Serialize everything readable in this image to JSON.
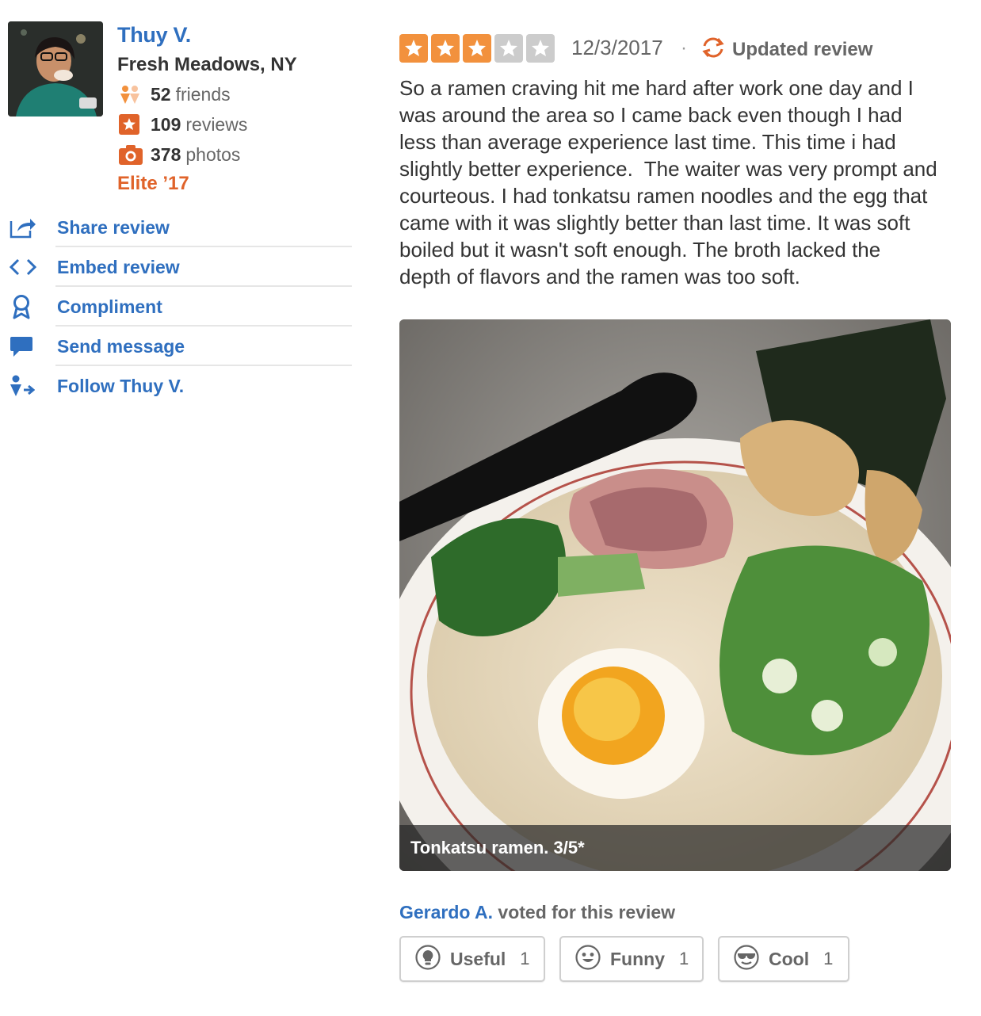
{
  "user": {
    "name": "Thuy V.",
    "location": "Fresh Meadows, NY",
    "friends_count": "52",
    "friends_label": "friends",
    "reviews_count": "109",
    "reviews_label": "reviews",
    "photos_count": "378",
    "photos_label": "photos",
    "elite": "Elite ’17"
  },
  "actions": {
    "share": "Share review",
    "embed": "Embed review",
    "compliment": "Compliment",
    "message": "Send message",
    "follow": "Follow Thuy V."
  },
  "review": {
    "rating": 3,
    "rating_max": 5,
    "date": "12/3/2017",
    "separator": "·",
    "updated_label": "Updated review",
    "text": "So a ramen craving hit me hard after work one day and I\nwas around the area so I came back even though I had\nless than average experience last time. This time i had\nslightly better experience.  The waiter was very prompt and\ncourteous. I had tonkatsu ramen noodles and the egg that\ncame with it was slightly better than last time. It was soft\nboiled but it wasn't soft enough. The broth lacked the\ndepth of flavors and the ramen was too soft.",
    "photo_caption": "Tonkatsu ramen. 3/5*"
  },
  "votes": {
    "voter": "Gerardo A.",
    "voted_text": " voted for this review",
    "useful_label": "Useful",
    "useful_count": "1",
    "funny_label": "Funny",
    "funny_count": "1",
    "cool_label": "Cool",
    "cool_count": "1"
  },
  "colors": {
    "link_blue": "#2f6fbf",
    "star_orange": "#f2913d",
    "star_empty": "#cccccc",
    "elite_orange": "#e0632a"
  }
}
